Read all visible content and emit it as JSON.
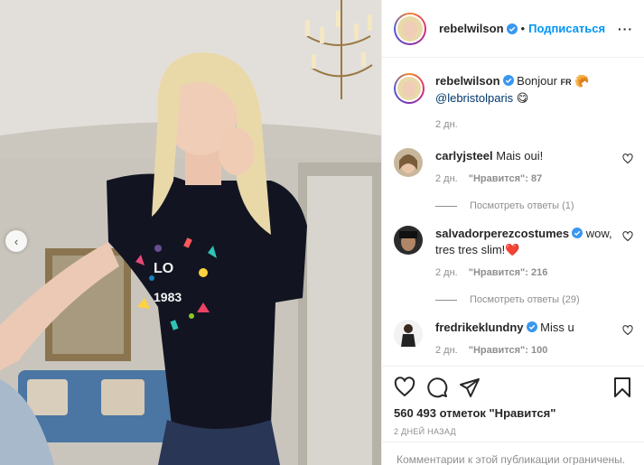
{
  "header": {
    "username": "rebelwilson",
    "separator": "•",
    "follow_label": "Подписаться",
    "more_label": "···"
  },
  "photo": {
    "shirt_text": [
      "LO",
      "1983"
    ],
    "nav_prev_glyph": "‹"
  },
  "caption": {
    "username": "rebelwilson",
    "text": "Bonjour",
    "flag": "FR",
    "emoji": "🥐",
    "mention": "@lebristolparis",
    "emoji2": "😋",
    "time": "2 дн."
  },
  "comments": [
    {
      "username": "carlyjsteel",
      "verified": false,
      "text": "Mais oui!",
      "time": "2 дн.",
      "likes": "\"Нравится\": 87",
      "replies": "Посмотреть ответы (1)"
    },
    {
      "username": "salvadorperezcostumes",
      "verified": true,
      "text": "wow, tres tres slim!❤️",
      "time": "2 дн.",
      "likes": "\"Нравится\": 216",
      "replies": "Посмотреть ответы (29)"
    },
    {
      "username": "fredrikeklundny",
      "verified": true,
      "text": "Miss u",
      "time": "2 дн.",
      "likes": "\"Нравится\": 100",
      "replies": ""
    }
  ],
  "actions": {
    "likes_total": "560 493 отметок \"Нравится\"",
    "date": "2 ДНЕЙ НАЗАД",
    "comments_disabled": "Комментарии к этой публикации ограничены."
  },
  "icons": {
    "like": "heart-icon",
    "comment": "comment-icon",
    "share": "share-icon",
    "save": "bookmark-icon",
    "verified": "verified-badge-icon",
    "more": "more-options-icon"
  },
  "colors": {
    "link": "#0095f6",
    "muted": "#8e8e8e",
    "verified": "#3897f0",
    "text": "#262626"
  }
}
